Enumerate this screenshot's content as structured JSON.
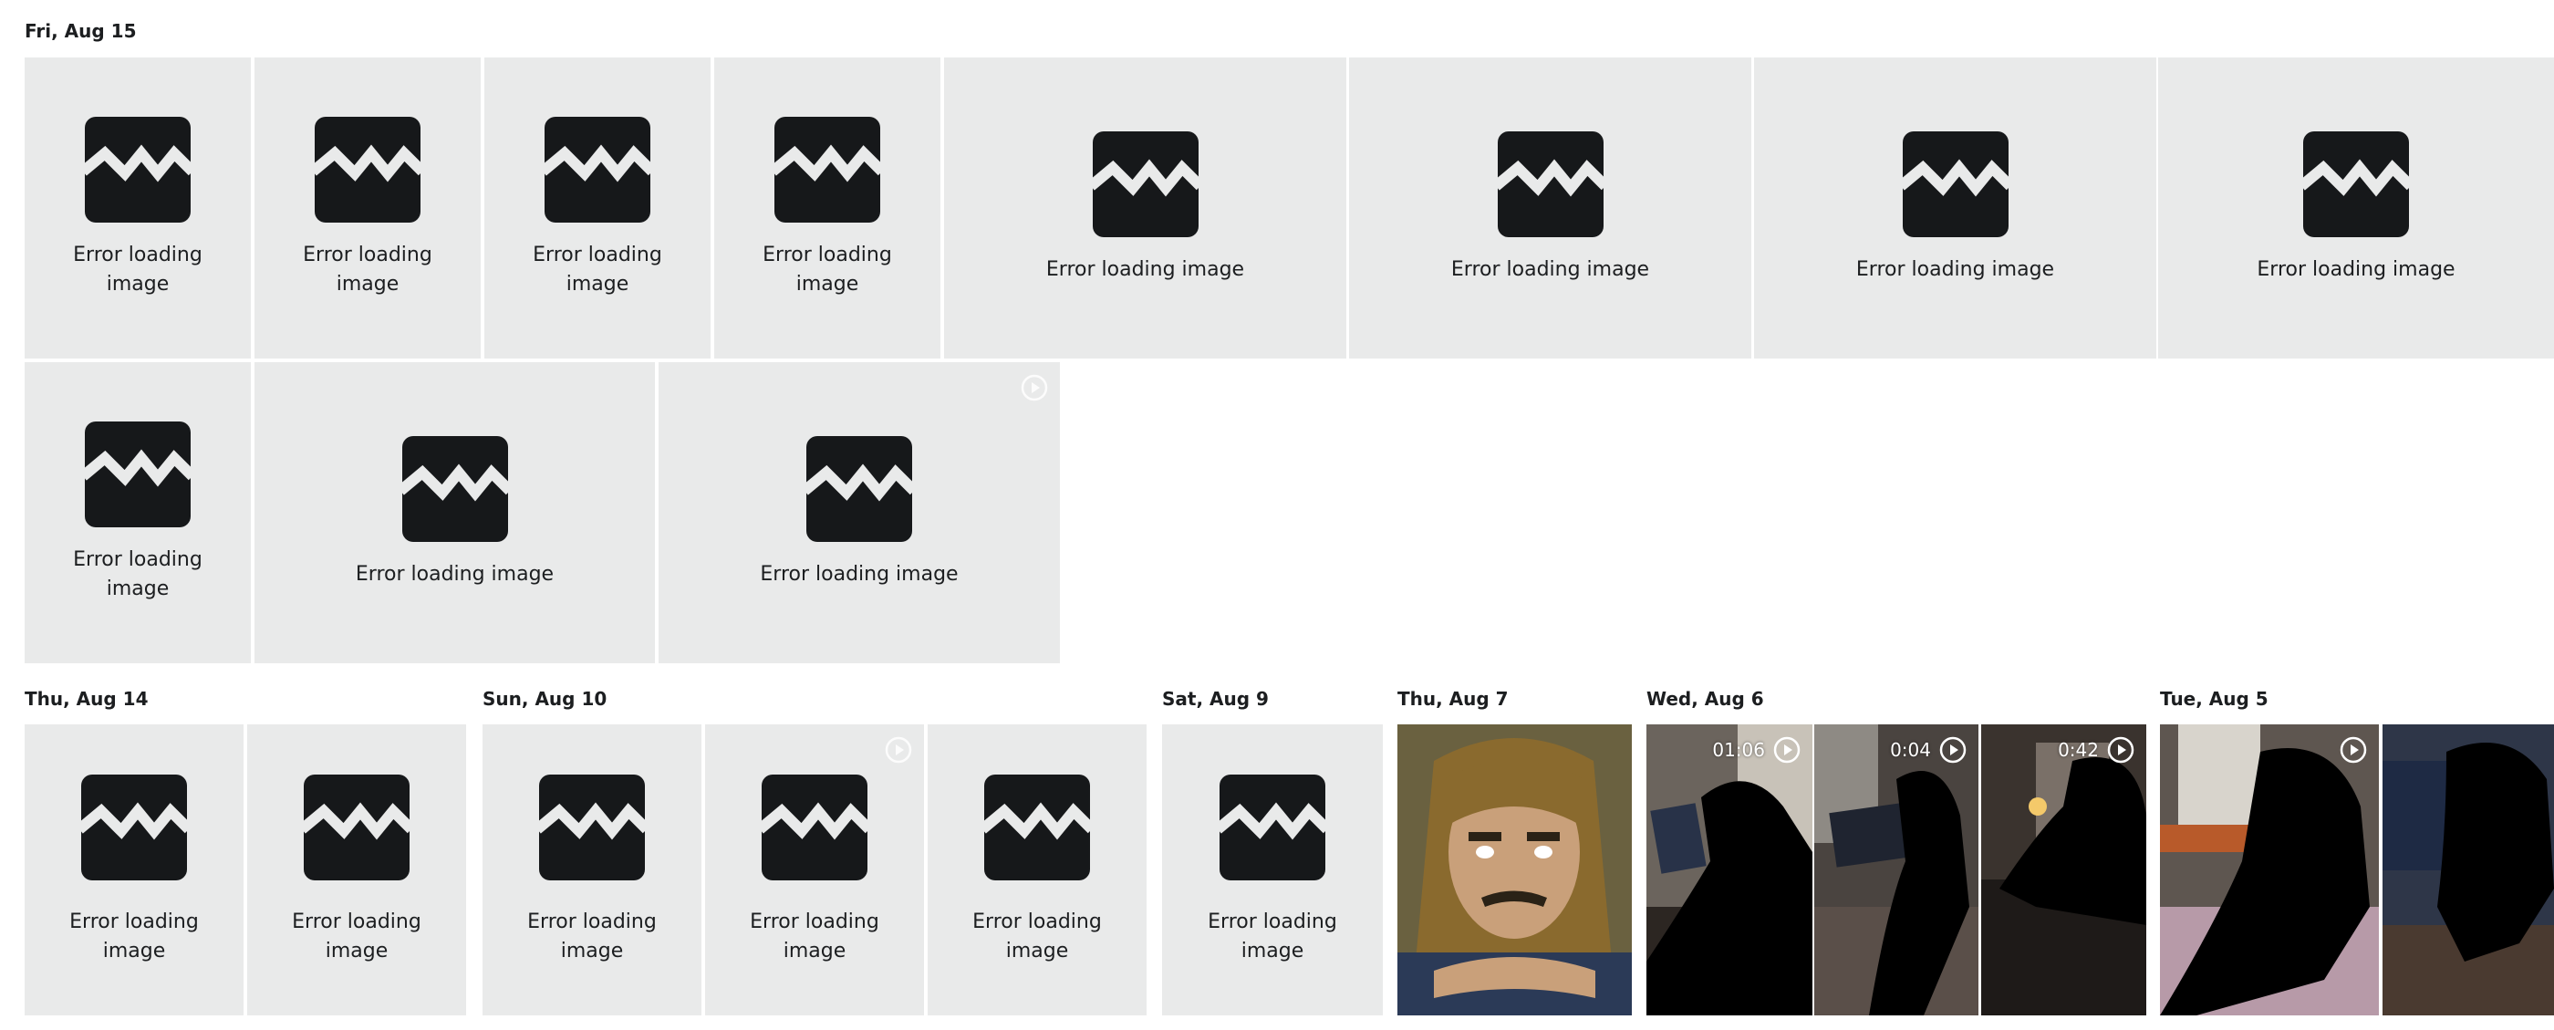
{
  "groups": {
    "aug15": {
      "label": "Fri, Aug 15"
    },
    "aug14": {
      "label": "Thu, Aug 14"
    },
    "aug10": {
      "label": "Sun, Aug 10"
    },
    "aug9": {
      "label": "Sat, Aug 9"
    },
    "aug7": {
      "label": "Thu, Aug 7"
    },
    "aug6": {
      "label": "Wed, Aug 6"
    },
    "aug5": {
      "label": "Tue, Aug 5"
    }
  },
  "error_text": "Error loading image",
  "videos": {
    "aug6_1": {
      "duration": "01:06"
    },
    "aug6_2": {
      "duration": "0:04"
    },
    "aug6_3": {
      "duration": "0:42"
    }
  },
  "icons": {
    "error": "broken-image-icon",
    "video": "play-circle-icon"
  },
  "colors": {
    "tile_bg": "#e9eaea",
    "icon": "#16181a",
    "background": "#ffffff"
  }
}
